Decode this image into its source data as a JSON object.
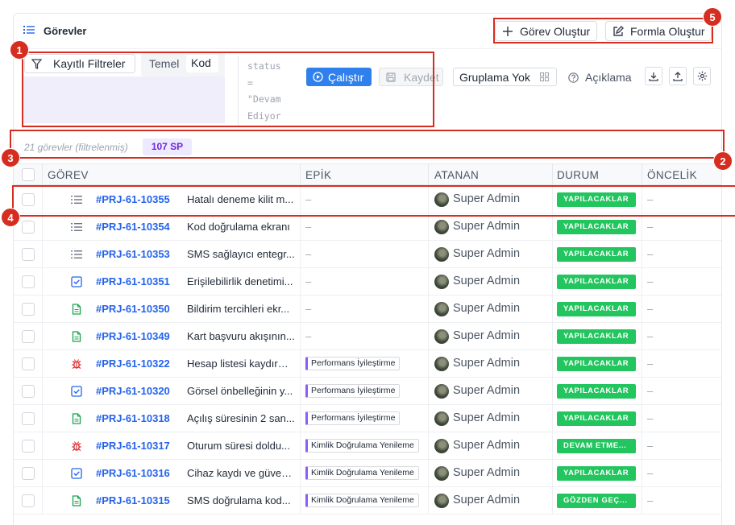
{
  "header": {
    "title": "Görevler",
    "create_task_label": "Görev Oluştur",
    "create_form_label": "Formla Oluştur"
  },
  "toolbar": {
    "saved_filters_label": "Kayıtlı Filtreler",
    "mode_basic": "Temel",
    "mode_code": "Kod",
    "query_text": "status\n=\n\"Devam\nEdiyor",
    "run_label": "Çalıştır",
    "save_label": "Kaydet",
    "grouping_label": "Gruplama Yok",
    "help_label": "Açıklama"
  },
  "summary": {
    "count_text": "21 görevler (filtrelenmiş)",
    "sp_badge": "107 SP"
  },
  "columns": [
    "GÖREV",
    "EPİK",
    "ATANAN",
    "DURUM",
    "ÖNCELİK"
  ],
  "annotations": [
    "1",
    "2",
    "3",
    "4",
    "5"
  ],
  "rows": [
    {
      "icon": "list-icon",
      "key": "#PRJ-61-10355",
      "title": "Hatalı deneme kilit m...",
      "epic": "–",
      "assignee": "Super Admin",
      "status": "YAPILACAKLAR",
      "priority": "–"
    },
    {
      "icon": "list-icon",
      "key": "#PRJ-61-10354",
      "title": "Kod doğrulama ekranı",
      "epic": "–",
      "assignee": "Super Admin",
      "status": "YAPILACAKLAR",
      "priority": "–"
    },
    {
      "icon": "list-icon",
      "key": "#PRJ-61-10353",
      "title": "SMS sağlayıcı entegr...",
      "epic": "–",
      "assignee": "Super Admin",
      "status": "YAPILACAKLAR",
      "priority": "–"
    },
    {
      "icon": "task-check-icon",
      "key": "#PRJ-61-10351",
      "title": "Erişilebilirlik denetimi...",
      "epic": "–",
      "assignee": "Super Admin",
      "status": "YAPILACAKLAR",
      "priority": "–"
    },
    {
      "icon": "story-doc-icon",
      "key": "#PRJ-61-10350",
      "title": "Bildirim tercihleri ekr...",
      "epic": "–",
      "assignee": "Super Admin",
      "status": "YAPILACAKLAR",
      "priority": "–"
    },
    {
      "icon": "story-doc-icon",
      "key": "#PRJ-61-10349",
      "title": "Kart başvuru akışının...",
      "epic": "–",
      "assignee": "Super Admin",
      "status": "YAPILACAKLAR",
      "priority": "–"
    },
    {
      "icon": "bug-icon",
      "key": "#PRJ-61-10322",
      "title": "Hesap listesi kaydırm...",
      "epic": "Performans İyileştirme",
      "assignee": "Super Admin",
      "status": "YAPILACAKLAR",
      "priority": "–"
    },
    {
      "icon": "task-check-icon",
      "key": "#PRJ-61-10320",
      "title": "Görsel önbelleğinin y...",
      "epic": "Performans İyileştirme",
      "assignee": "Super Admin",
      "status": "YAPILACAKLAR",
      "priority": "–"
    },
    {
      "icon": "story-doc-icon",
      "key": "#PRJ-61-10318",
      "title": "Açılış süresinin 2 san...",
      "epic": "Performans İyileştirme",
      "assignee": "Super Admin",
      "status": "YAPILACAKLAR",
      "priority": "–"
    },
    {
      "icon": "bug-icon",
      "key": "#PRJ-61-10317",
      "title": "Oturum süresi doldu...",
      "epic": "Kimlik Doğrulama Yenileme",
      "assignee": "Super Admin",
      "status": "DEVAM ETME...",
      "priority": "–"
    },
    {
      "icon": "task-check-icon",
      "key": "#PRJ-61-10316",
      "title": "Cihaz kaydı ve güven...",
      "epic": "Kimlik Doğrulama Yenileme",
      "assignee": "Super Admin",
      "status": "YAPILACAKLAR",
      "priority": "–"
    },
    {
      "icon": "story-doc-icon",
      "key": "#PRJ-61-10315",
      "title": "SMS doğrulama kod...",
      "epic": "Kimlik Doğrulama Yenileme",
      "assignee": "Super Admin",
      "status": "GÖZDEN GEÇ...",
      "priority": "–"
    }
  ],
  "colors": {
    "accent": "#2f80ed",
    "status_green": "#22c55e",
    "epic_bar": "#8b5cf6",
    "annotation_red": "#d62d20"
  }
}
